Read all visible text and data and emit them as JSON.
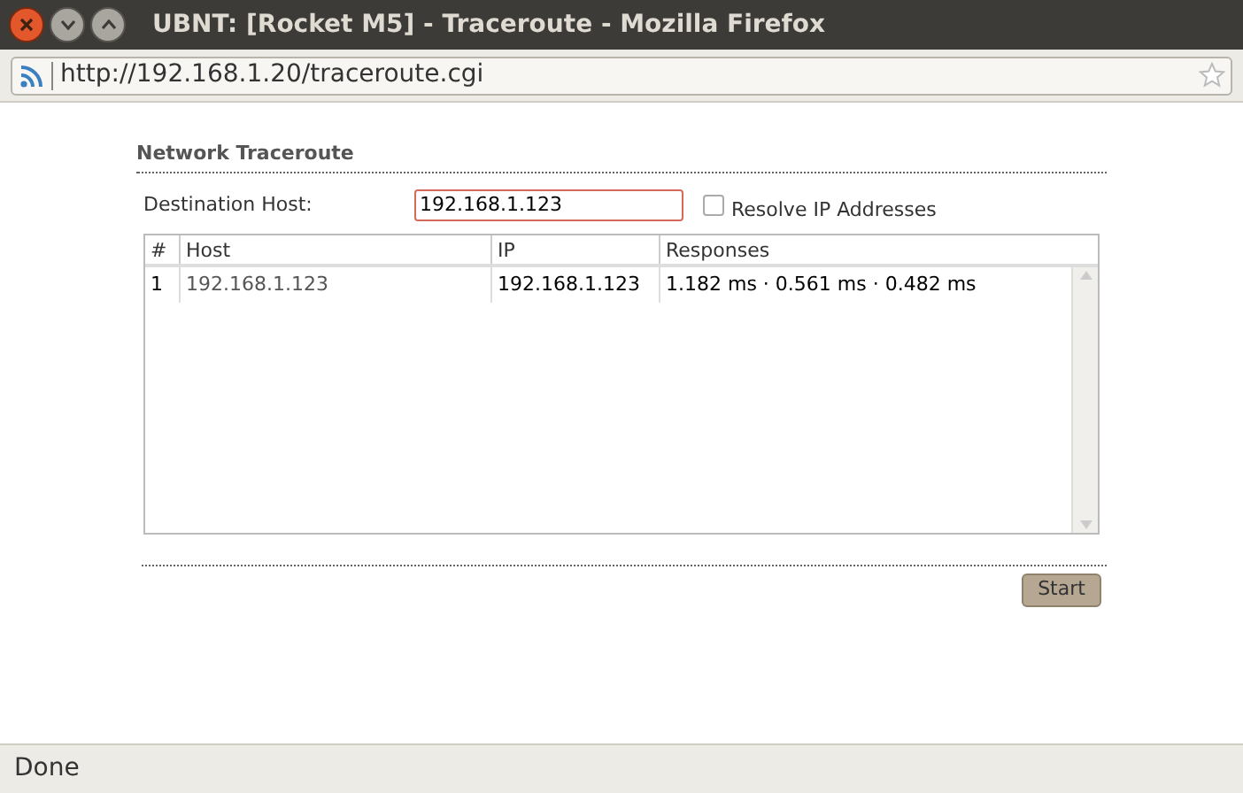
{
  "window": {
    "title": "UBNT: [Rocket M5] - Traceroute - Mozilla Firefox"
  },
  "address_bar": {
    "url": "http://192.168.1.20/traceroute.cgi"
  },
  "section": {
    "title": "Network Traceroute"
  },
  "form": {
    "destination_label": "Destination Host:",
    "destination_value": "192.168.1.123",
    "resolve_label": "Resolve IP Addresses",
    "resolve_checked": false
  },
  "table": {
    "columns": [
      "#",
      "Host",
      "IP",
      "Responses"
    ],
    "rows": [
      [
        "1",
        "192.168.1.123",
        "192.168.1.123",
        "1.182 ms · 0.561 ms · 0.482 ms"
      ]
    ]
  },
  "start_button": "Start",
  "status_bar": "Done"
}
